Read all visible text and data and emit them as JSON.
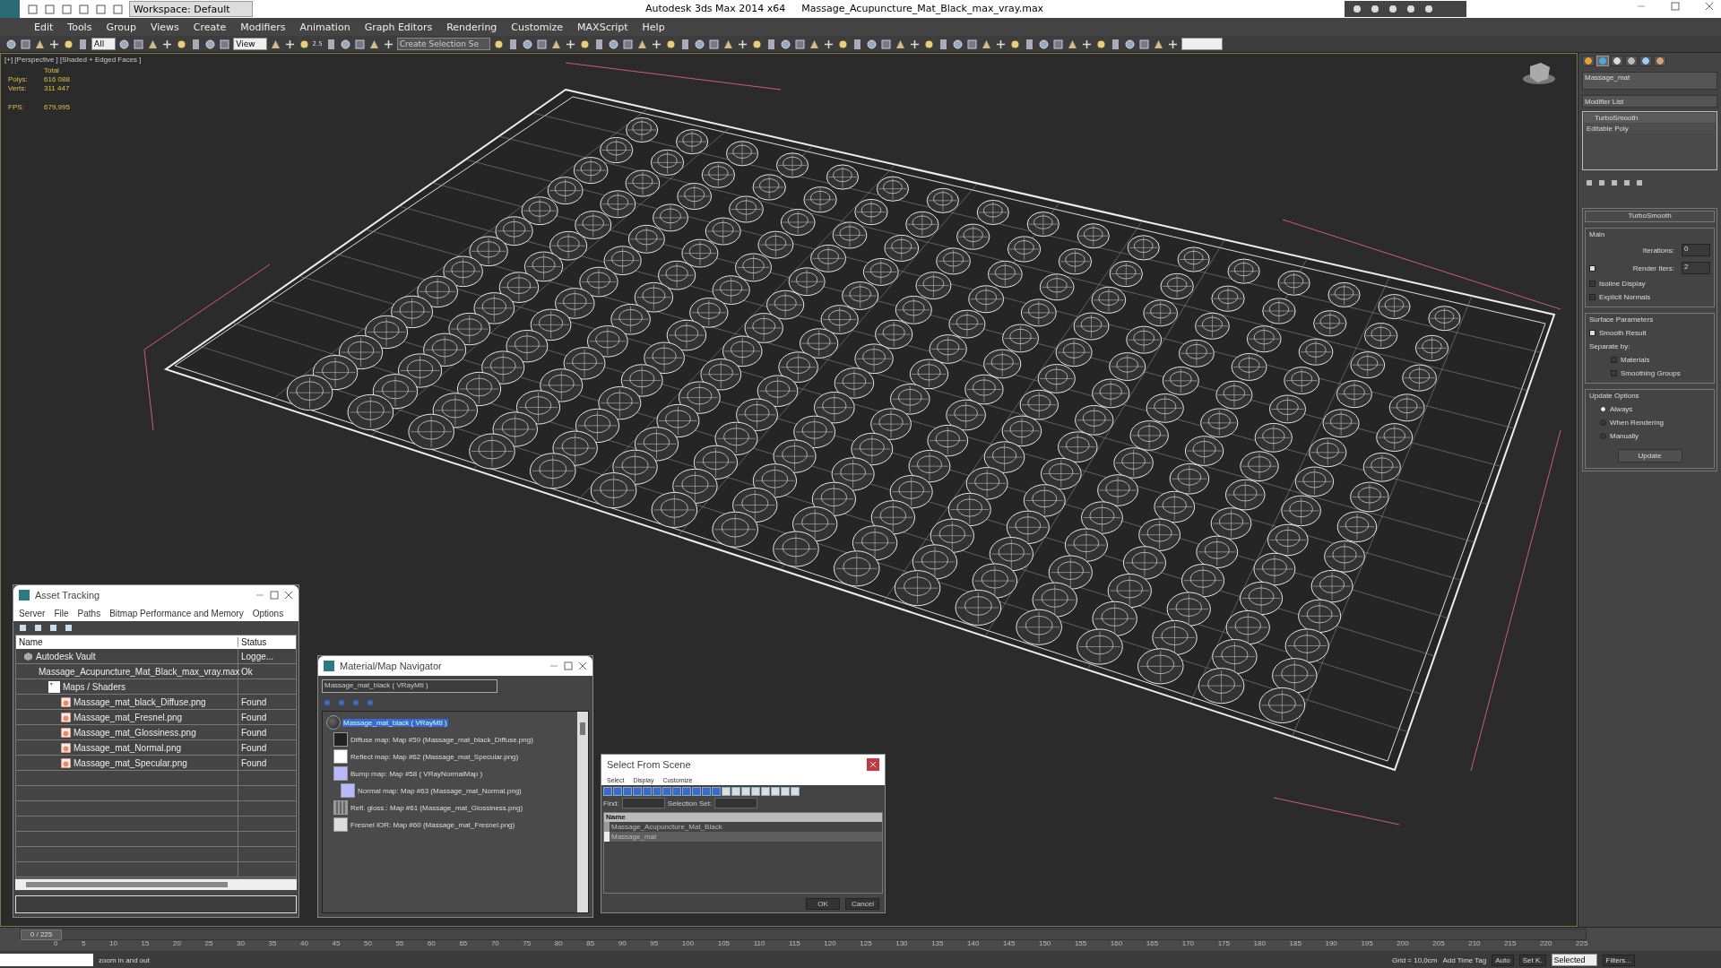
{
  "title_bar": {
    "workspace": "Workspace: Default",
    "app": "Autodesk 3ds Max  2014 x64",
    "file": "Massage_Acupuncture_Mat_Black_max_vray.max"
  },
  "menu": [
    "Edit",
    "Tools",
    "Group",
    "Views",
    "Create",
    "Modifiers",
    "Animation",
    "Graph Editors",
    "Rendering",
    "Customize",
    "MAXScript",
    "Help"
  ],
  "toolbar": {
    "filter": "All",
    "coords": "View",
    "snap_angle": "2.5",
    "named_selection": "Create Selection Se"
  },
  "viewport": {
    "label": "[+] [Perspective ] [Shaded + Edged Faces ]",
    "stats_header": "Total",
    "stats": [
      {
        "label": "Polys:",
        "value": "616 088"
      },
      {
        "label": "Verts:",
        "value": "311 447"
      }
    ],
    "fps_label": "FPS:",
    "fps": "679,995"
  },
  "command_panel": {
    "tabs": [
      {
        "kind": "create",
        "selected": false
      },
      {
        "kind": "modify",
        "selected": true
      },
      {
        "kind": "hierarchy",
        "selected": false
      },
      {
        "kind": "motion",
        "selected": false
      },
      {
        "kind": "display",
        "selected": false
      },
      {
        "kind": "utilities",
        "selected": false
      }
    ],
    "object_name": "Massage_mat",
    "modifier_list": "Modifier List",
    "stack": [
      {
        "kind": "modifier",
        "label": "TurboSmooth"
      },
      {
        "kind": "base",
        "label": "Editable Poly"
      }
    ],
    "rollout_title": "TurboSmooth",
    "main": {
      "title": "Main",
      "iterations_label": "Iterations:",
      "iterations": "0",
      "render_iters_label": "Render Iters:",
      "render_iters": "2",
      "render_iters_checked": true,
      "isoline": {
        "label": "Isoline Display",
        "checked": false
      },
      "explicit": {
        "label": "Explicit Normals",
        "checked": false
      }
    },
    "surface": {
      "title": "Surface Parameters",
      "smooth": {
        "label": "Smooth Result",
        "checked": true
      },
      "separate_label": "Separate by:",
      "materials": {
        "label": "Materials",
        "checked": false
      },
      "groups": {
        "label": "Smoothing Groups",
        "checked": false
      }
    },
    "update": {
      "title": "Update Options",
      "options": [
        {
          "label": "Always",
          "selected": true
        },
        {
          "label": "When Rendering",
          "selected": false
        },
        {
          "label": "Manually",
          "selected": false
        }
      ],
      "button": "Update"
    }
  },
  "asset_tracking": {
    "title": "Asset Tracking",
    "menu": [
      "Server",
      "File",
      "Paths",
      "Bitmap Performance and Memory",
      "Options"
    ],
    "columns": [
      "Name",
      "Status"
    ],
    "rows": [
      {
        "kind": "vault",
        "name": "Autodesk Vault",
        "status": "Logge...",
        "children": [
          {
            "kind": "max",
            "name": "Massage_Acupuncture_Mat_Black_max_vray.max",
            "status": "Ok",
            "children": [
              {
                "kind": "folder",
                "name": "Maps / Shaders",
                "children": [
                  {
                    "kind": "png",
                    "name": "Massage_mat_black_Diffuse.png",
                    "status": "Found"
                  },
                  {
                    "kind": "png",
                    "name": "Massage_mat_Fresnel.png",
                    "status": "Found"
                  },
                  {
                    "kind": "png",
                    "name": "Massage_mat_Glossiness.png",
                    "status": "Found"
                  },
                  {
                    "kind": "png",
                    "name": "Massage_mat_Normal.png",
                    "status": "Found"
                  },
                  {
                    "kind": "png",
                    "name": "Massage_mat_Specular.png",
                    "status": "Found"
                  }
                ]
              }
            ]
          }
        ]
      }
    ]
  },
  "material_navigator": {
    "title": "Material/Map Navigator",
    "field": "Massage_mat_black  ( VRayMtl )",
    "tree": [
      {
        "kind": "sphere",
        "label": "Massage_mat_black  ( VRayMtl )",
        "selected": true,
        "children": [
          {
            "kind": "dark",
            "label": "Diffuse map: Map #59 (Massage_mat_black_Diffuse.png)",
            "selected": false
          },
          {
            "kind": "white",
            "label": "Reflect map: Map #62 (Massage_mat_Specular.png)",
            "selected": false
          },
          {
            "kind": "blue",
            "label": "Bump map: Map #58  ( VRayNormalMap )",
            "selected": false,
            "children": [
              {
                "kind": "blue",
                "label": "Normal map: Map #63 (Massage_mat_Normal.png)",
                "selected": false
              }
            ]
          },
          {
            "kind": "noise",
            "label": "Refl. gloss.: Map #61 (Massage_mat_Glossiness.png)",
            "selected": false
          },
          {
            "kind": "light",
            "label": "Fresnel IOR: Map #60 (Massage_mat_Fresnel.png)",
            "selected": false
          }
        ]
      }
    ]
  },
  "select_from_scene": {
    "title": "Select From Scene",
    "menu": [
      "Select",
      "Display",
      "Customize"
    ],
    "find_label": "Find:",
    "set_label": "Selection Set:",
    "column": "Name",
    "rows": [
      {
        "kind": "group",
        "label": "Massage_Acupuncture_Mat_Black",
        "selected": false
      },
      {
        "kind": "geometry",
        "label": "Massage_mat",
        "selected": true
      }
    ],
    "ok": "OK",
    "cancel": "Cancel"
  },
  "timeline": {
    "frame": "0 / 225",
    "level": 0,
    "ticks": [
      "0",
      "5",
      "10",
      "15",
      "20",
      "25",
      "30",
      "35",
      "40",
      "45",
      "50",
      "55",
      "60",
      "65",
      "70",
      "75",
      "80",
      "85",
      "90",
      "95",
      "100",
      "105",
      "110",
      "115",
      "120",
      "125",
      "130",
      "135",
      "140",
      "145",
      "150",
      "155",
      "160",
      "165",
      "170",
      "175",
      "180",
      "185",
      "190",
      "195",
      "200",
      "205",
      "210",
      "215",
      "220",
      "225"
    ]
  },
  "status_bar": {
    "prompt": "zoom in and out",
    "grid": "Grid = 10,0cm",
    "auto": "Auto",
    "key_filter": "Selected",
    "set_key": "Set K.",
    "filters": "Filters...",
    "time_tag": "Add Time Tag"
  }
}
